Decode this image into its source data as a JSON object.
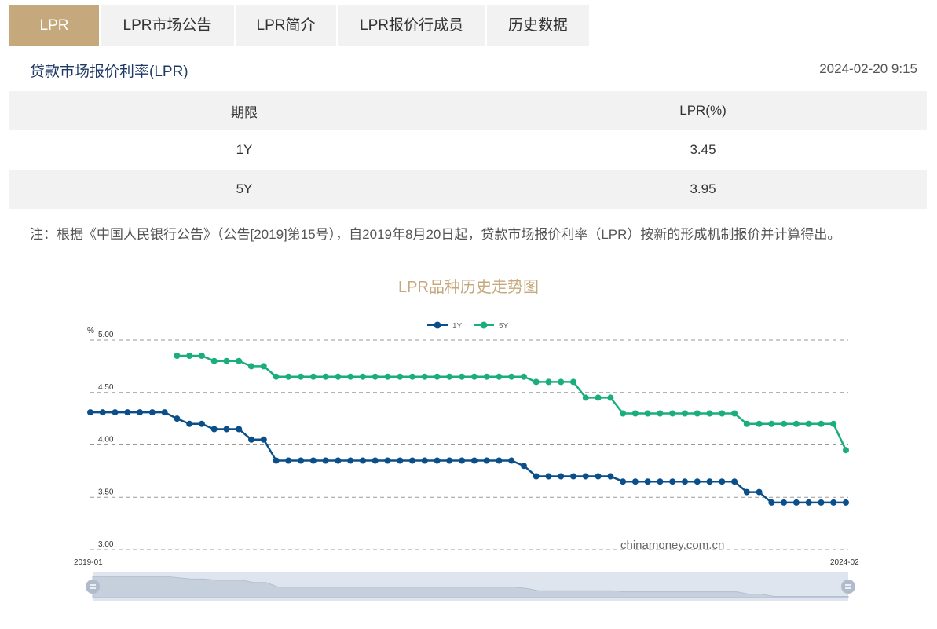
{
  "tabs": [
    {
      "label": "LPR",
      "active": true
    },
    {
      "label": "LPR市场公告",
      "active": false
    },
    {
      "label": "LPR简介",
      "active": false
    },
    {
      "label": "LPR报价行成员",
      "active": false
    },
    {
      "label": "历史数据",
      "active": false
    }
  ],
  "header": {
    "title": "贷款市场报价利率(LPR)",
    "timestamp": "2024-02-20 9:15"
  },
  "table": {
    "columns": [
      "期限",
      "LPR(%)"
    ],
    "rows": [
      [
        "1Y",
        "3.45"
      ],
      [
        "5Y",
        "3.95"
      ]
    ]
  },
  "note": "注：根据《中国人民银行公告》（公告[2019]第15号），自2019年8月20日起，贷款市场报价利率（LPR）按新的形成机制报价并计算得出。",
  "colors": {
    "accent": "#c5a97d",
    "series_1y": "#0b4f8a",
    "series_5y": "#1aae7a"
  },
  "chart_data": {
    "type": "line",
    "title": "LPR品种历史走势图",
    "ylabel": "%",
    "ylim": [
      3.0,
      5.0
    ],
    "yticks": [
      "3.00",
      "3.50",
      "4.00",
      "4.50",
      "5.00"
    ],
    "x_start_label": "2019-01",
    "x_end_label": "2024-02",
    "watermark": "chinamoney.com.cn",
    "grid": true,
    "legend_position": "top-center",
    "x": [
      "2019-01",
      "2019-02",
      "2019-03",
      "2019-04",
      "2019-05",
      "2019-06",
      "2019-07",
      "2019-08",
      "2019-09",
      "2019-10",
      "2019-11",
      "2019-12",
      "2020-01",
      "2020-02",
      "2020-03",
      "2020-04",
      "2020-05",
      "2020-06",
      "2020-07",
      "2020-08",
      "2020-09",
      "2020-10",
      "2020-11",
      "2020-12",
      "2021-01",
      "2021-02",
      "2021-03",
      "2021-04",
      "2021-05",
      "2021-06",
      "2021-07",
      "2021-08",
      "2021-09",
      "2021-10",
      "2021-11",
      "2021-12",
      "2022-01",
      "2022-02",
      "2022-03",
      "2022-04",
      "2022-05",
      "2022-06",
      "2022-07",
      "2022-08",
      "2022-09",
      "2022-10",
      "2022-11",
      "2022-12",
      "2023-01",
      "2023-02",
      "2023-03",
      "2023-04",
      "2023-05",
      "2023-06",
      "2023-07",
      "2023-08",
      "2023-09",
      "2023-10",
      "2023-11",
      "2023-12",
      "2024-01",
      "2024-02"
    ],
    "series": [
      {
        "name": "1Y",
        "values": [
          4.31,
          4.31,
          4.31,
          4.31,
          4.31,
          4.31,
          4.31,
          4.25,
          4.2,
          4.2,
          4.15,
          4.15,
          4.15,
          4.05,
          4.05,
          3.85,
          3.85,
          3.85,
          3.85,
          3.85,
          3.85,
          3.85,
          3.85,
          3.85,
          3.85,
          3.85,
          3.85,
          3.85,
          3.85,
          3.85,
          3.85,
          3.85,
          3.85,
          3.85,
          3.85,
          3.8,
          3.7,
          3.7,
          3.7,
          3.7,
          3.7,
          3.7,
          3.7,
          3.65,
          3.65,
          3.65,
          3.65,
          3.65,
          3.65,
          3.65,
          3.65,
          3.65,
          3.65,
          3.55,
          3.55,
          3.45,
          3.45,
          3.45,
          3.45,
          3.45,
          3.45,
          3.45
        ]
      },
      {
        "name": "5Y",
        "values": [
          null,
          null,
          null,
          null,
          null,
          null,
          null,
          4.85,
          4.85,
          4.85,
          4.8,
          4.8,
          4.8,
          4.75,
          4.75,
          4.65,
          4.65,
          4.65,
          4.65,
          4.65,
          4.65,
          4.65,
          4.65,
          4.65,
          4.65,
          4.65,
          4.65,
          4.65,
          4.65,
          4.65,
          4.65,
          4.65,
          4.65,
          4.65,
          4.65,
          4.65,
          4.6,
          4.6,
          4.6,
          4.6,
          4.45,
          4.45,
          4.45,
          4.3,
          4.3,
          4.3,
          4.3,
          4.3,
          4.3,
          4.3,
          4.3,
          4.3,
          4.3,
          4.2,
          4.2,
          4.2,
          4.2,
          4.2,
          4.2,
          4.2,
          4.2,
          3.95
        ]
      }
    ]
  }
}
